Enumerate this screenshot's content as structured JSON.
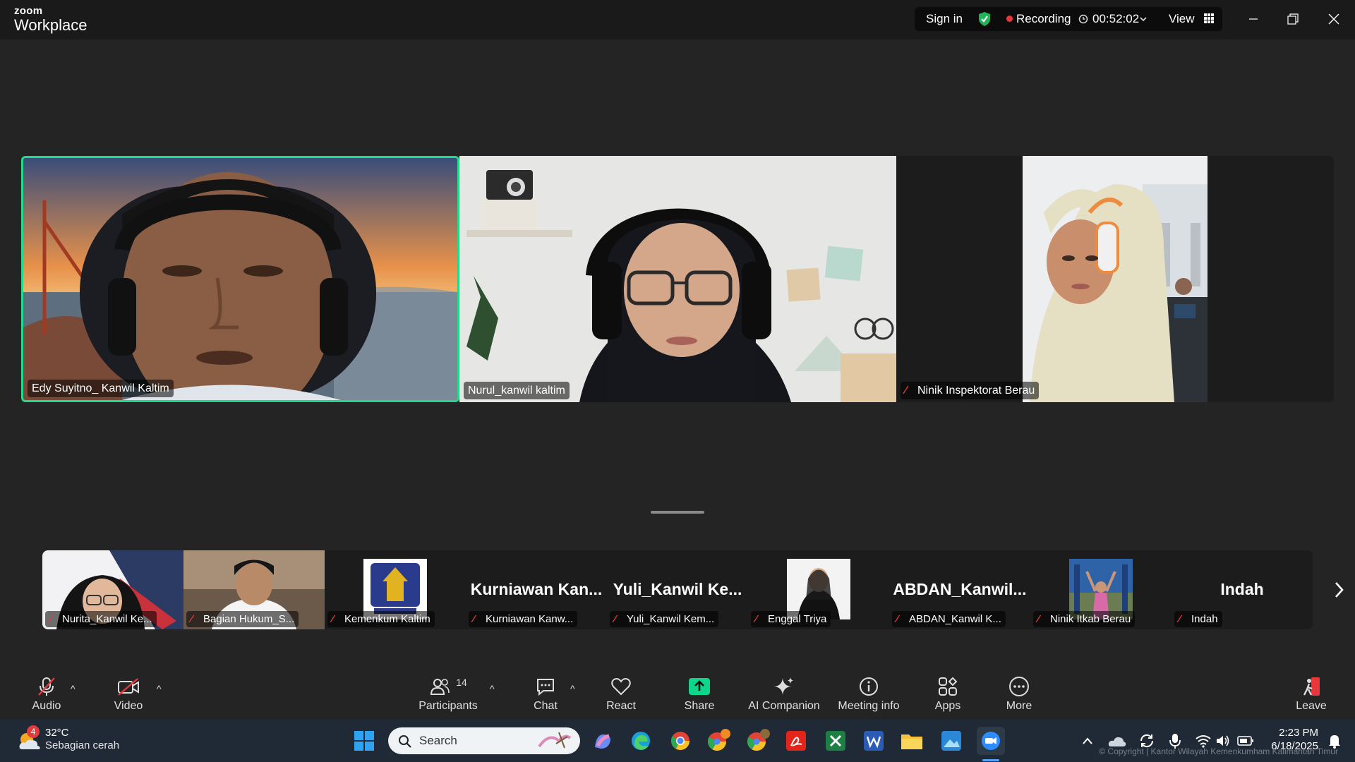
{
  "window": {
    "brand_top": "zoom",
    "brand_bottom": "Workplace",
    "sign_in": "Sign in",
    "recording": "Recording",
    "timer": "00:52:02",
    "view": "View"
  },
  "speakers": [
    {
      "name": "Edy Suyitno_ Kanwil Kaltim",
      "active": true
    },
    {
      "name": "Nurul_kanwil kaltim"
    },
    {
      "name": "Ninik Inspektorat Berau",
      "muted": true
    }
  ],
  "thumbnails": [
    {
      "name": "Nurita_Kanwil Ke...",
      "muted": true
    },
    {
      "name": "Bagian Hukum_S...",
      "muted": true
    },
    {
      "name": "Kemenkum Kaltim",
      "muted": true
    },
    {
      "name": "Kurniawan Kanw...",
      "big": "Kurniawan  Kan...",
      "muted": true
    },
    {
      "name": "Yuli_Kanwil Kem...",
      "big": "Yuli_Kanwil  Ke...",
      "muted": true
    },
    {
      "name": "Enggal Triya",
      "muted": true
    },
    {
      "name": "ABDAN_Kanwil K...",
      "big": "ABDAN_Kanwil...",
      "muted": true
    },
    {
      "name": "Ninik Itkab Berau",
      "muted": true
    },
    {
      "name": "Indah",
      "big": "Indah",
      "muted": true
    }
  ],
  "toolbar": {
    "audio": "Audio",
    "video": "Video",
    "participants": "Participants",
    "participants_count": "14",
    "chat": "Chat",
    "react": "React",
    "share": "Share",
    "ai": "AI Companion",
    "meeting_info": "Meeting info",
    "apps": "Apps",
    "more": "More",
    "leave": "Leave"
  },
  "taskbar": {
    "temp": "32°C",
    "weather": "Sebagian cerah",
    "weather_badge": "4",
    "search": "Search",
    "time": "2:23 PM",
    "date": "6/18/2025",
    "copyright": "© Copyright | Kantor Wilayah Kemenkumham Kalimantan Timur"
  },
  "colors": {
    "active_border": "#1fdc8c",
    "share_green": "#0bd68a",
    "recording_red": "#e8383d",
    "leave_red": "#e8383d"
  }
}
